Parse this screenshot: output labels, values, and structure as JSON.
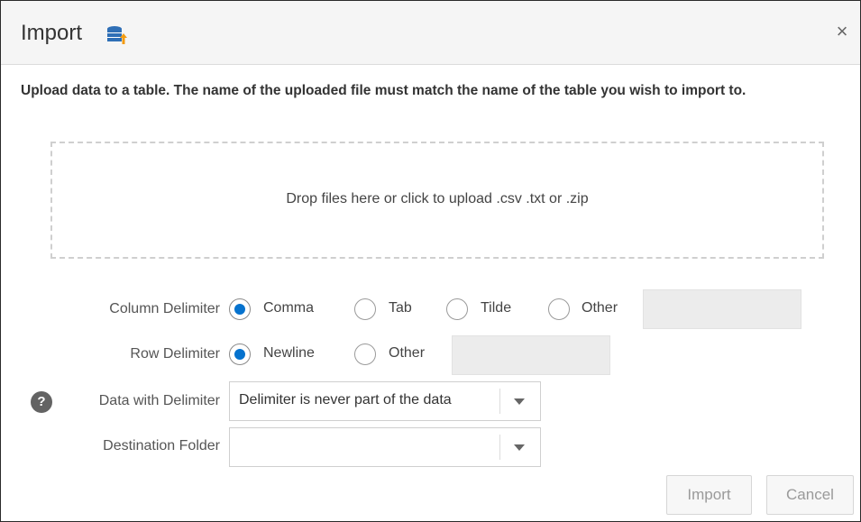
{
  "dialog": {
    "title": "Import",
    "title_icon": "database-upload-icon",
    "close_label": "×",
    "description": "Upload data to a table. The name of the uploaded file must match the name of the table you wish to import to."
  },
  "dropzone": {
    "text": "Drop files here or click to upload .csv .txt or .zip"
  },
  "column_delimiter": {
    "label": "Column Delimiter",
    "options": [
      "Comma",
      "Tab",
      "Tilde",
      "Other"
    ],
    "selected": "Comma",
    "other_value": ""
  },
  "row_delimiter": {
    "label": "Row Delimiter",
    "options": [
      "Newline",
      "Other"
    ],
    "selected": "Newline",
    "other_value": ""
  },
  "data_with_delimiter": {
    "label": "Data with Delimiter",
    "help_icon": "?",
    "value": "Delimiter is never part of the data"
  },
  "destination_folder": {
    "label": "Destination Folder",
    "value": ""
  },
  "buttons": {
    "import_label": "Import",
    "cancel_label": "Cancel"
  },
  "colors": {
    "accent": "#0572ce",
    "titlebar": "#f5f5f5",
    "disabled_text": "#9a9a9a"
  }
}
